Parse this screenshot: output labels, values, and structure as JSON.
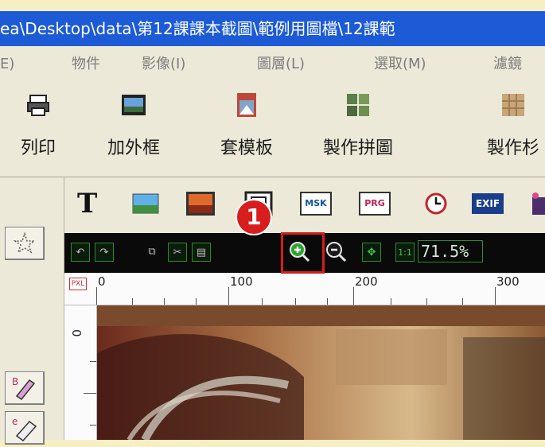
{
  "window": {
    "title": "ea\\Desktop\\data\\第12課課本截圖\\範例用圖檔\\12課範"
  },
  "menubar": {
    "items": [
      "E)",
      "物件",
      "影像(I)",
      "圖層(L)",
      "選取(M)",
      "濾鏡"
    ]
  },
  "toolbar": {
    "buttons": [
      {
        "label": "列印",
        "icon": "printer-icon"
      },
      {
        "label": "加外框",
        "icon": "frame-photo-icon"
      },
      {
        "label": "套模板",
        "icon": "template-photo-icon"
      },
      {
        "label": "製作拼圖",
        "icon": "collage-icon"
      },
      {
        "label": "製作杉",
        "icon": "make-icon"
      }
    ]
  },
  "toolbar2": {
    "items": [
      {
        "label": "T",
        "icon": "text-icon"
      },
      {
        "label": "",
        "icon": "landscape-icon"
      },
      {
        "label": "",
        "icon": "sunset-icon"
      },
      {
        "label": "",
        "icon": "frame-icon"
      },
      {
        "label": "MSK",
        "icon": "mask-icon"
      },
      {
        "label": "PRG",
        "icon": "program-icon"
      },
      {
        "label": "",
        "icon": "clock-icon"
      },
      {
        "label": "EXIF",
        "icon": "exif-icon"
      }
    ]
  },
  "zoombar": {
    "undo": "↶",
    "redo": "↷",
    "copy": "⧉",
    "cut": "✂",
    "paste": "▤",
    "zoom_in": "+",
    "zoom_out": "−",
    "fit": "✥",
    "actual": "1:1",
    "zoom_value": "71.5%"
  },
  "ruler": {
    "unit": "PXL",
    "marks": [
      "0",
      "100",
      "200",
      "300"
    ],
    "vmark": "0"
  },
  "callout": {
    "number": "1"
  },
  "colors": {
    "title_bg": "#1d5bd6",
    "highlight": "#d71d1d",
    "zoom_green": "#2a8d2a"
  }
}
